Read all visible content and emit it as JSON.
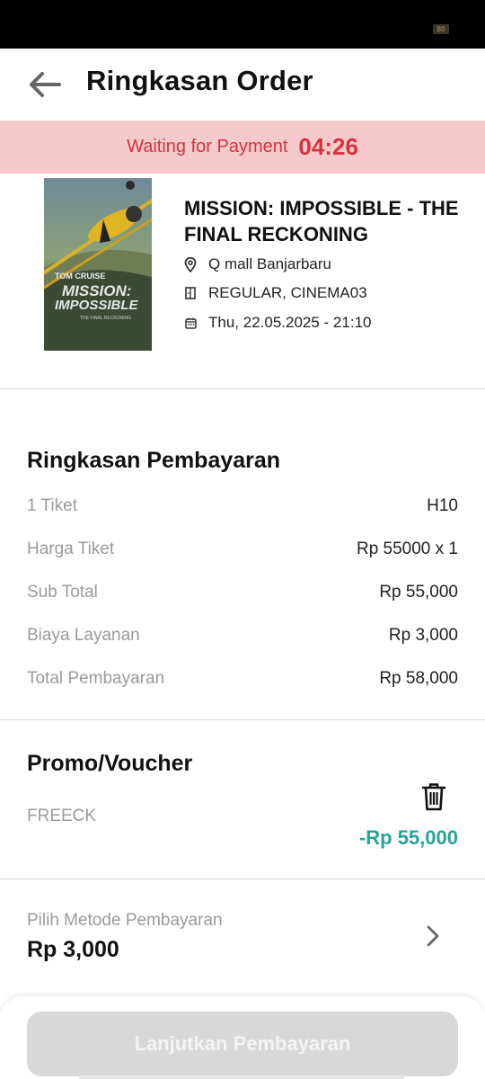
{
  "status_bar": {
    "battery_text": "80"
  },
  "header": {
    "title": "Ringkasan Order"
  },
  "banner": {
    "label": "Waiting for Payment",
    "timer": "04:26"
  },
  "movie": {
    "title": "MISSION: IMPOSSIBLE - THE FINAL RECKONING",
    "location": "Q mall Banjarbaru",
    "studio": "REGULAR, CINEMA03",
    "schedule": "Thu, 22.05.2025 - 21:10",
    "poster": {
      "top_text": "TOM CRUISE",
      "logo_line1": "MISSION:",
      "logo_line2": "IMPOSSIBLE",
      "subtitle": "THE FINAL RECKONING"
    }
  },
  "summary": {
    "title": "Ringkasan Pembayaran",
    "rows": [
      {
        "label": "1 Tiket",
        "value": "H10"
      },
      {
        "label": "Harga Tiket",
        "value": "Rp 55000 x 1"
      },
      {
        "label": "Sub Total",
        "value": "Rp 55,000"
      },
      {
        "label": "Biaya Layanan",
        "value": "Rp 3,000"
      },
      {
        "label": "Total Pembayaran",
        "value": "Rp 58,000"
      }
    ]
  },
  "promo": {
    "title": "Promo/Voucher",
    "code": "FREECK",
    "discount": "-Rp 55,000"
  },
  "payment_method": {
    "label": "Pilih Metode Pembayaran",
    "amount": "Rp 3,000"
  },
  "footer": {
    "button_label": "Lanjutkan Pembayaran"
  },
  "colors": {
    "banner_bg": "#f6c9cb",
    "banner_text": "#d5333f",
    "discount": "#25a59a",
    "button_disabled": "#d8d8d8"
  }
}
